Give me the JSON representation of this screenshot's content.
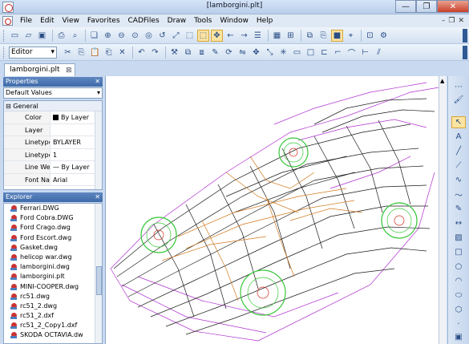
{
  "window": {
    "title": "[lamborgini.plt]"
  },
  "menu": [
    "File",
    "Edit",
    "View",
    "Favorites",
    "CADFiles",
    "Draw",
    "Tools",
    "Window",
    "Help"
  ],
  "toolbar2": {
    "mode_select": "Editor"
  },
  "doc_tab": {
    "label": "lamborgini.plt"
  },
  "properties": {
    "title": "Properties",
    "filter": "Default Values",
    "group": "General",
    "rows": [
      {
        "name": "Color",
        "value": "By Layer"
      },
      {
        "name": "Layer",
        "value": ""
      },
      {
        "name": "Linetype",
        "value": "BYLAYER"
      },
      {
        "name": "Linetype",
        "value": "1"
      },
      {
        "name": "Line We",
        "value": "— By Layer"
      },
      {
        "name": "Font Na",
        "value": "Arial"
      }
    ]
  },
  "explorer": {
    "title": "Explorer",
    "files": [
      "Ferrari.DWG",
      "Ford Cobra.DWG",
      "Ford Crago.dwg",
      "Ford Escort.dwg",
      "Gasket.dwg",
      "helicop war.dwg",
      "lamborgini.dwg",
      "lamborgini.plt",
      "MINI-COOPER.dwg",
      "rc51.dwg",
      "rc51_2.dwg",
      "rc51_2.dxf",
      "rc51_2_Copy1.dxf",
      "SKODA OCTAVIA.dw"
    ]
  },
  "colors": {
    "wire_black": "#1a1a1a",
    "wire_purple": "#b030d0",
    "wire_orange": "#d07a20",
    "wheel_green": "#39c83a",
    "hub_red": "#d03020"
  }
}
